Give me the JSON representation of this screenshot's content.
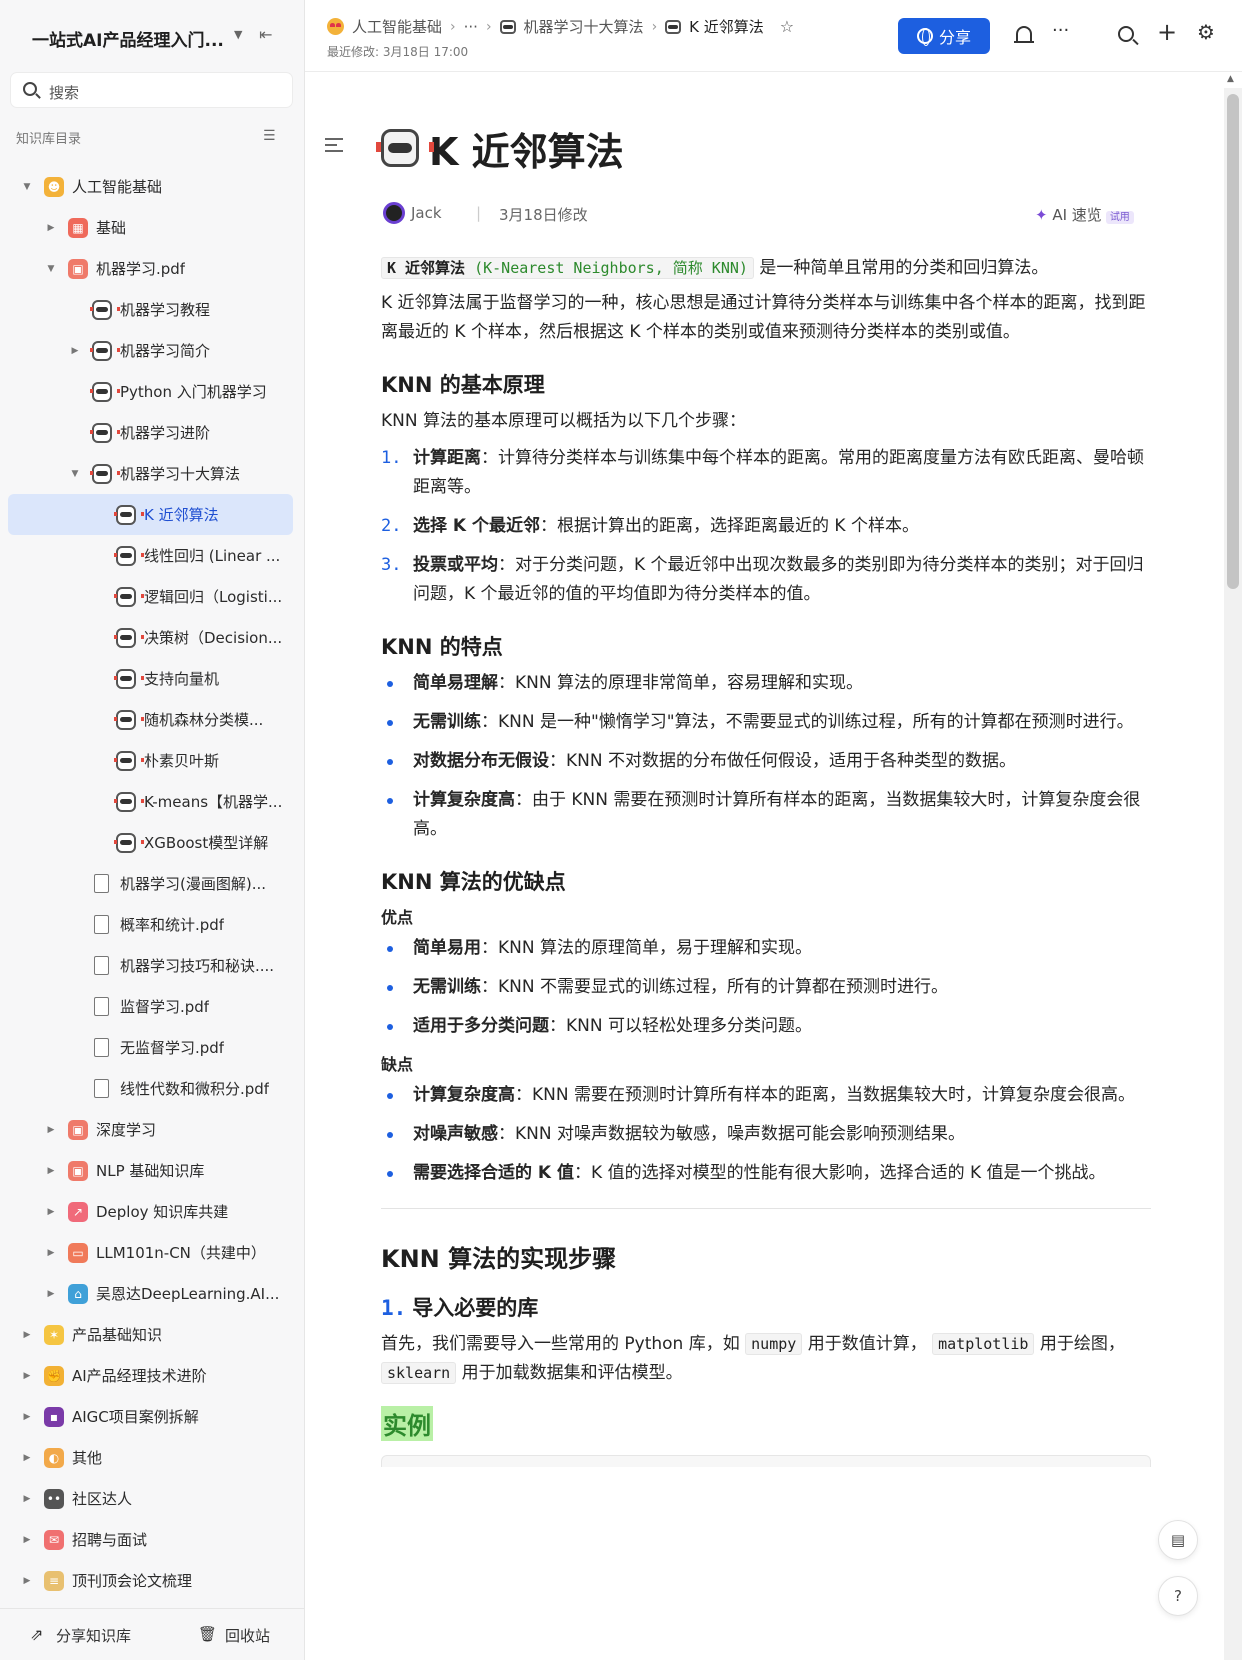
{
  "sidebar": {
    "kb_title": "一站式AI产品经理入门...",
    "search_placeholder": "搜索",
    "toc_label": "知识库目录",
    "items": [
      {
        "label": "人工智能基础",
        "indent": 0,
        "caret": "down",
        "icon": "emoji"
      },
      {
        "label": "基础",
        "indent": 1,
        "caret": "right",
        "icon": "grid"
      },
      {
        "label": "机器学习.pdf",
        "indent": 1,
        "caret": "down",
        "icon": "box"
      },
      {
        "label": "机器学习教程",
        "indent": 2,
        "caret": "",
        "icon": "robot"
      },
      {
        "label": "机器学习简介",
        "indent": 2,
        "caret": "right",
        "icon": "robot"
      },
      {
        "label": "Python 入门机器学习",
        "indent": 2,
        "caret": "",
        "icon": "robot"
      },
      {
        "label": "机器学习进阶",
        "indent": 2,
        "caret": "",
        "icon": "robot"
      },
      {
        "label": "机器学习十大算法",
        "indent": 2,
        "caret": "down",
        "icon": "robot"
      },
      {
        "label": "K 近邻算法",
        "indent": 3,
        "caret": "",
        "icon": "robot",
        "selected": true
      },
      {
        "label": "线性回归 (Linear ...",
        "indent": 3,
        "caret": "",
        "icon": "robot"
      },
      {
        "label": "逻辑回归（Logisti...",
        "indent": 3,
        "caret": "",
        "icon": "robot"
      },
      {
        "label": "决策树（Decision...",
        "indent": 3,
        "caret": "",
        "icon": "robot"
      },
      {
        "label": "支持向量机",
        "indent": 3,
        "caret": "",
        "icon": "robot"
      },
      {
        "label": "随机森林分类模...",
        "indent": 3,
        "caret": "",
        "icon": "robot"
      },
      {
        "label": "朴素贝叶斯",
        "indent": 3,
        "caret": "",
        "icon": "robot"
      },
      {
        "label": "K-means【机器学...",
        "indent": 3,
        "caret": "",
        "icon": "robot"
      },
      {
        "label": "XGBoost模型详解",
        "indent": 3,
        "caret": "",
        "icon": "robot"
      },
      {
        "label": "机器学习(漫画图解)...",
        "indent": 2,
        "caret": "",
        "icon": "pdf"
      },
      {
        "label": "概率和统计.pdf",
        "indent": 2,
        "caret": "",
        "icon": "pdf"
      },
      {
        "label": "机器学习技巧和秘诀....",
        "indent": 2,
        "caret": "",
        "icon": "pdf"
      },
      {
        "label": "监督学习.pdf",
        "indent": 2,
        "caret": "",
        "icon": "pdf"
      },
      {
        "label": "无监督学习.pdf",
        "indent": 2,
        "caret": "",
        "icon": "pdf"
      },
      {
        "label": "线性代数和微积分.pdf",
        "indent": 2,
        "caret": "",
        "icon": "pdf"
      },
      {
        "label": "深度学习",
        "indent": 1,
        "caret": "right",
        "icon": "box"
      },
      {
        "label": "NLP 基础知识库",
        "indent": 1,
        "caret": "right",
        "icon": "box"
      },
      {
        "label": "Deploy 知识库共建",
        "indent": 1,
        "caret": "right",
        "icon": "chart"
      },
      {
        "label": "LLM101n-CN（共建中）",
        "indent": 1,
        "caret": "right",
        "icon": "screen"
      },
      {
        "label": "吴恩达DeepLearning.AI...",
        "indent": 1,
        "caret": "right",
        "icon": "house"
      },
      {
        "label": "产品基础知识",
        "indent": 0,
        "caret": "right",
        "icon": "dizzy"
      },
      {
        "label": "AI产品经理技术进阶",
        "indent": 0,
        "caret": "right",
        "icon": "muscle"
      },
      {
        "label": "AIGC项目案例拆解",
        "indent": 0,
        "caret": "right",
        "icon": "floppy"
      },
      {
        "label": "其他",
        "indent": 0,
        "caret": "right",
        "icon": "palette"
      },
      {
        "label": "社区达人",
        "indent": 0,
        "caret": "right",
        "icon": "eyes"
      },
      {
        "label": "招聘与面试",
        "indent": 0,
        "caret": "right",
        "icon": "mail"
      },
      {
        "label": "顶刊顶会论文梳理",
        "indent": 0,
        "caret": "right",
        "icon": "scroll"
      }
    ],
    "footer": {
      "share": "分享知识库",
      "trash": "回收站"
    }
  },
  "topbar": {
    "crumbs": [
      "人工智能基础",
      "···",
      "机器学习十大算法",
      "K 近邻算法"
    ],
    "last_modified": "最近修改: 3月18日 17:00",
    "share_label": "分享"
  },
  "doc": {
    "title": "K 近邻算法",
    "author": "Jack",
    "modified": "3月18日修改",
    "ai_label": "AI 速览",
    "ai_tag": "试用",
    "intro_code_bold": "K 近邻算法",
    "intro_code_green": " (K-Nearest Neighbors, 简称 KNN)",
    "intro_rest": "是一种简单且常用的分类和回归算法。",
    "para2": "K 近邻算法属于监督学习的一种，核心思想是通过计算待分类样本与训练集中各个样本的距离，找到距离最近的 K 个样本，然后根据这 K 个样本的类别或值来预测待分类样本的类别或值。",
    "h_principle": "KNN 的基本原理",
    "principle_intro": "KNN 算法的基本原理可以概括为以下几个步骤：",
    "steps": [
      {
        "n": "1.",
        "b": "计算距离",
        "t": "：计算待分类样本与训练集中每个样本的距离。常用的距离度量方法有欧氏距离、曼哈顿距离等。"
      },
      {
        "n": "2.",
        "b": "选择 K 个最近邻",
        "t": "：根据计算出的距离，选择距离最近的 K 个样本。"
      },
      {
        "n": "3.",
        "b": "投票或平均",
        "t": "：对于分类问题，K 个最近邻中出现次数最多的类别即为待分类样本的类别；对于回归问题，K 个最近邻的值的平均值即为待分类样本的值。"
      }
    ],
    "h_features": "KNN 的特点",
    "features": [
      {
        "b": "简单易理解",
        "t": "：KNN 算法的原理非常简单，容易理解和实现。"
      },
      {
        "b": "无需训练",
        "t": "：KNN 是一种\"懒惰学习\"算法，不需要显式的训练过程，所有的计算都在预测时进行。"
      },
      {
        "b": "对数据分布无假设",
        "t": "：KNN 不对数据的分布做任何假设，适用于各种类型的数据。"
      },
      {
        "b": "计算复杂度高",
        "t": "：由于 KNN 需要在预测时计算所有样本的距离，当数据集较大时，计算复杂度会很高。"
      }
    ],
    "h_proscons": "KNN 算法的优缺点",
    "pros_label": "优点",
    "pros": [
      {
        "b": "简单易用",
        "t": "：KNN 算法的原理简单，易于理解和实现。"
      },
      {
        "b": "无需训练",
        "t": "：KNN 不需要显式的训练过程，所有的计算都在预测时进行。"
      },
      {
        "b": "适用于多分类问题",
        "t": "：KNN 可以轻松处理多分类问题。"
      }
    ],
    "cons_label": "缺点",
    "cons": [
      {
        "b": "计算复杂度高",
        "t": "：KNN 需要在预测时计算所有样本的距离，当数据集较大时，计算复杂度会很高。"
      },
      {
        "b": "对噪声敏感",
        "t": "：KNN 对噪声数据较为敏感，噪声数据可能会影响预测结果。"
      },
      {
        "b": "需要选择合适的 K 值",
        "t": "：K 值的选择对模型的性能有很大影响，选择合适的 K 值是一个挑战。"
      }
    ],
    "h_impl": "KNN 算法的实现步骤",
    "h_import_num": "1.",
    "h_import": "导入必要的库",
    "import_p1": "首先，我们需要导入一些常用的 Python 库，如",
    "code_numpy": "numpy",
    "import_p2": "用于数值计算，",
    "code_mpl": "matplotlib",
    "import_p3": "用于绘图，",
    "code_sk": "sklearn",
    "import_p4": "用于加载数据集和评估模型。",
    "example": "实例"
  }
}
